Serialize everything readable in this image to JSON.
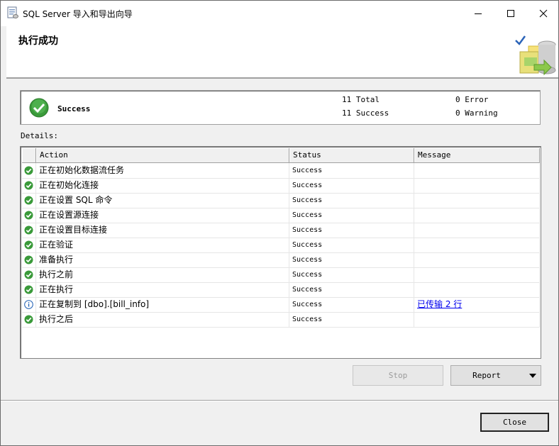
{
  "window": {
    "title": "SQL Server 导入和导出向导",
    "header_title": "执行成功"
  },
  "summary": {
    "status": "Success",
    "total": "11 Total",
    "success": "11 Success",
    "error": "0 Error",
    "warning": "0 Warning"
  },
  "details_label": "Details:",
  "grid": {
    "columns": [
      "Action",
      "Status",
      "Message"
    ],
    "rows": [
      {
        "icon": "success-icon",
        "action": "正在初始化数据流任务",
        "status": "Success",
        "message": ""
      },
      {
        "icon": "success-icon",
        "action": "正在初始化连接",
        "status": "Success",
        "message": ""
      },
      {
        "icon": "success-icon",
        "action": "正在设置 SQL 命令",
        "status": "Success",
        "message": ""
      },
      {
        "icon": "success-icon",
        "action": "正在设置源连接",
        "status": "Success",
        "message": ""
      },
      {
        "icon": "success-icon",
        "action": "正在设置目标连接",
        "status": "Success",
        "message": ""
      },
      {
        "icon": "success-icon",
        "action": "正在验证",
        "status": "Success",
        "message": ""
      },
      {
        "icon": "success-icon",
        "action": "准备执行",
        "status": "Success",
        "message": ""
      },
      {
        "icon": "success-icon",
        "action": "执行之前",
        "status": "Success",
        "message": ""
      },
      {
        "icon": "success-icon",
        "action": "正在执行",
        "status": "Success",
        "message": ""
      },
      {
        "icon": "info-icon",
        "action": "正在复制到 [dbo].[bill_info]",
        "status": "Success",
        "message": "已传输 2 行"
      },
      {
        "icon": "success-icon",
        "action": "执行之后",
        "status": "Success",
        "message": ""
      }
    ]
  },
  "buttons": {
    "stop": "Stop",
    "report": "Report",
    "close": "Close"
  },
  "colors": {
    "success_green": "#3a9a3a",
    "link_blue": "#0000ee",
    "info_blue": "#1e5fb4"
  }
}
